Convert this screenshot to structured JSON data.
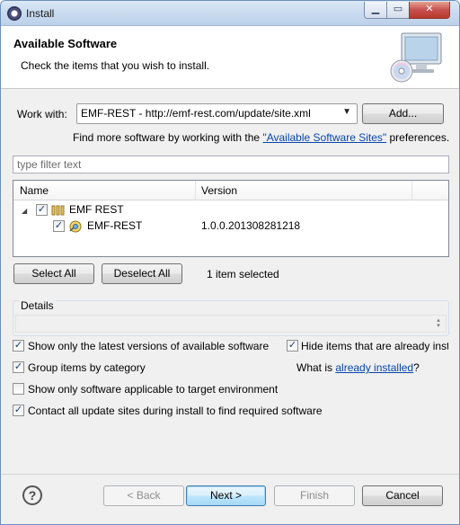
{
  "window": {
    "title": "Install",
    "icons": {
      "app": "eclipse-icon",
      "minimize": "minimize-icon",
      "maximize": "maximize-icon",
      "close": "close-icon"
    }
  },
  "header": {
    "title": "Available Software",
    "description": "Check the items that you wish to install.",
    "icon": "monitor-cd-icon"
  },
  "work_with": {
    "label": "Work with:",
    "value": "EMF-REST - http://emf-rest.com/update/site.xml",
    "add_button": "Add...",
    "find_more_prefix": "Find more software by working with the",
    "find_more_link": "\"Available Software Sites\"",
    "find_more_suffix": "preferences."
  },
  "filter": {
    "placeholder": "type filter text"
  },
  "tree": {
    "columns": [
      "Name",
      "Version"
    ],
    "category": {
      "name": "EMF REST",
      "checked": true,
      "expanded": true
    },
    "feature": {
      "name": "EMF-REST",
      "version": "1.0.0.201308281218",
      "checked": true
    }
  },
  "selection": {
    "select_all": "Select All",
    "deselect_all": "Deselect All",
    "status": "1 item selected"
  },
  "details": {
    "label": "Details"
  },
  "options": {
    "latest_versions": {
      "label": "Show only the latest versions of available software",
      "checked": true
    },
    "hide_installed": {
      "label": "Hide items that are already installed",
      "checked": true
    },
    "group_by_category": {
      "label": "Group items by category",
      "checked": true
    },
    "applicable_only": {
      "label": "Show only software applicable to target environment",
      "checked": false
    },
    "contact_sites": {
      "label": "Contact all update sites during install to find required software",
      "checked": true
    },
    "what_is_prefix": "What is",
    "already_installed_link": "already installed",
    "what_is_suffix": "?"
  },
  "footer": {
    "help": "?",
    "back": "< Back",
    "next": "Next >",
    "finish": "Finish",
    "cancel": "Cancel"
  }
}
